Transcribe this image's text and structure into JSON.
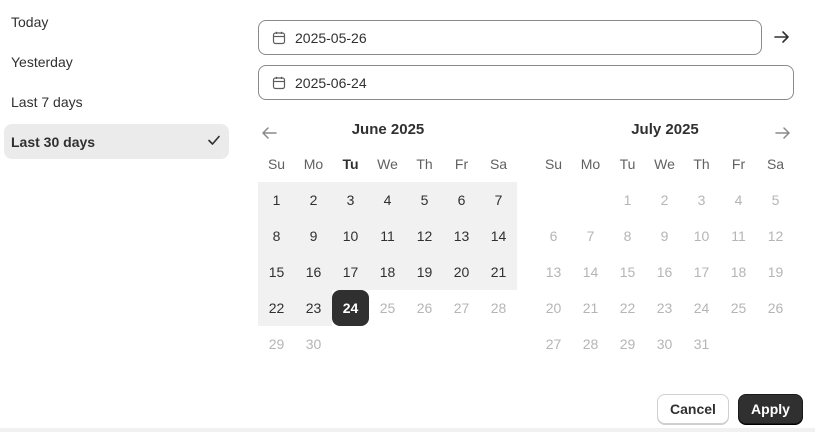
{
  "presets": [
    {
      "label": "Today",
      "selected": false
    },
    {
      "label": "Yesterday",
      "selected": false
    },
    {
      "label": "Last 7 days",
      "selected": false
    },
    {
      "label": "Last 30 days",
      "selected": true
    }
  ],
  "fields": {
    "start_value": "2025-05-26",
    "end_value": "2025-06-24"
  },
  "icons": {
    "calendar": "calendar-icon",
    "arrow_right": "arrow-right-icon",
    "arrow_left": "arrow-left-icon",
    "check": "checkmark-icon"
  },
  "calendar": {
    "june": {
      "title": "June 2025",
      "weekdays": [
        "Su",
        "Mo",
        "Tu",
        "We",
        "Th",
        "Fr",
        "Sa"
      ],
      "highlight_weekday": "Tu",
      "weeks": [
        [
          "1",
          "2",
          "3",
          "4",
          "5",
          "6",
          "7"
        ],
        [
          "8",
          "9",
          "10",
          "11",
          "12",
          "13",
          "14"
        ],
        [
          "15",
          "16",
          "17",
          "18",
          "19",
          "20",
          "21"
        ],
        [
          "22",
          "23",
          "24",
          "25",
          "26",
          "27",
          "28"
        ],
        [
          "29",
          "30",
          "",
          "",
          "",
          "",
          ""
        ]
      ],
      "in_range_days": [
        "1",
        "2",
        "3",
        "4",
        "5",
        "6",
        "7",
        "8",
        "9",
        "10",
        "11",
        "12",
        "13",
        "14",
        "15",
        "16",
        "17",
        "18",
        "19",
        "20",
        "21",
        "22",
        "23"
      ],
      "selected_day": "24"
    },
    "july": {
      "title": "July 2025",
      "weekdays": [
        "Su",
        "Mo",
        "Tu",
        "We",
        "Th",
        "Fr",
        "Sa"
      ],
      "weeks": [
        [
          "",
          "",
          "1",
          "2",
          "3",
          "4",
          "5"
        ],
        [
          "6",
          "7",
          "8",
          "9",
          "10",
          "11",
          "12"
        ],
        [
          "13",
          "14",
          "15",
          "16",
          "17",
          "18",
          "19"
        ],
        [
          "20",
          "21",
          "22",
          "23",
          "24",
          "25",
          "26"
        ],
        [
          "27",
          "28",
          "29",
          "30",
          "31",
          "",
          ""
        ]
      ]
    }
  },
  "buttons": {
    "cancel": "Cancel",
    "apply": "Apply"
  },
  "colors": {
    "selected_bg": "#303030",
    "range_bg": "#f1f1f1",
    "disabled_text": "#b5b5b5"
  }
}
